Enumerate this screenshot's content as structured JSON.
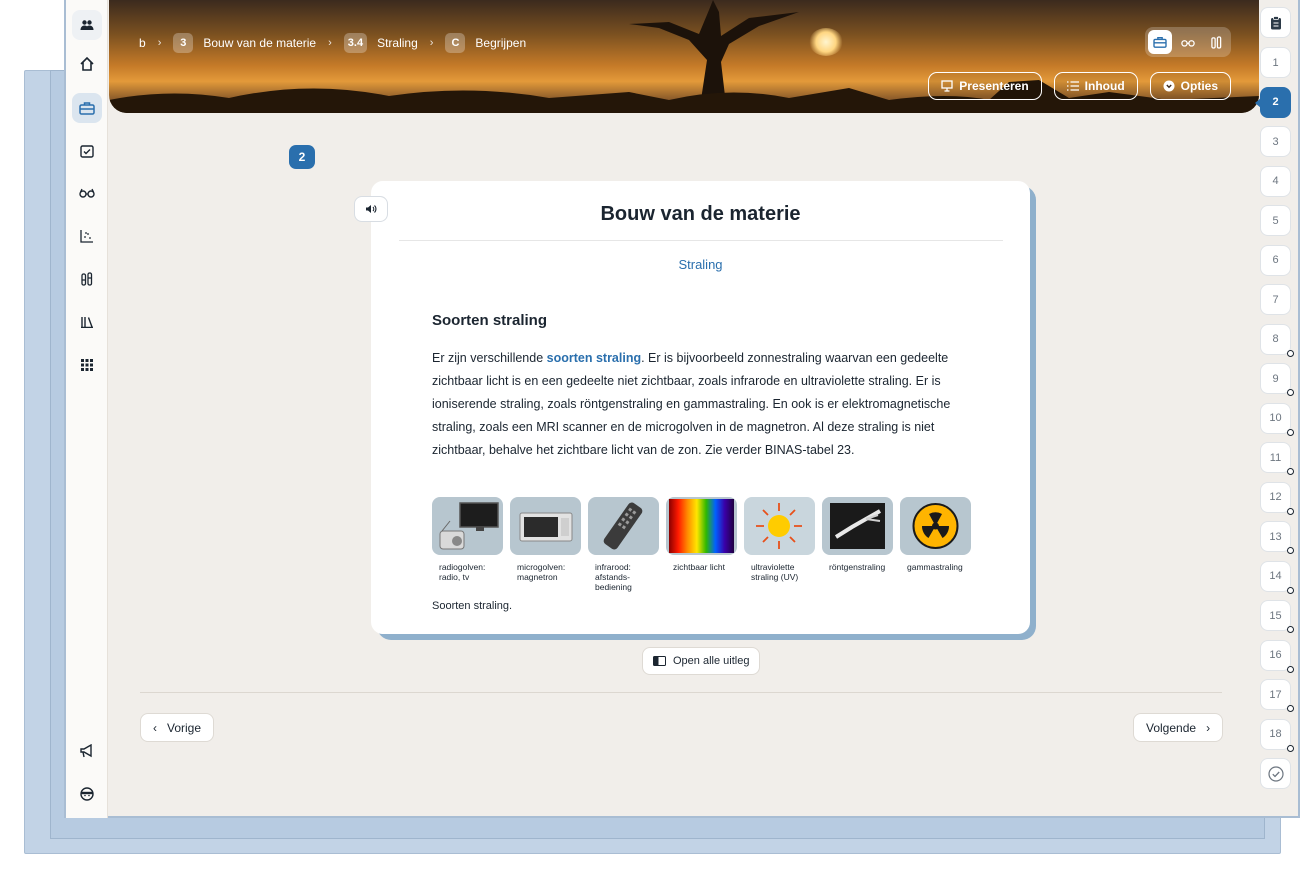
{
  "rail": {
    "items": [
      {
        "icon": "group-icon",
        "glyph": "👥"
      },
      {
        "icon": "home-icon",
        "glyph": "⌂"
      },
      {
        "icon": "briefcase-icon",
        "glyph": "💼"
      },
      {
        "icon": "task-calendar-icon",
        "glyph": "☑"
      },
      {
        "icon": "glasses-icon",
        "glyph": "👓"
      },
      {
        "icon": "chart-icon",
        "glyph": "⁙"
      },
      {
        "icon": "test-tubes-icon",
        "glyph": "⫿"
      },
      {
        "icon": "library-icon",
        "glyph": "ⅲ"
      },
      {
        "icon": "apps-grid-icon",
        "glyph": "⠿"
      },
      {
        "icon": "megaphone-icon",
        "glyph": "📣"
      },
      {
        "icon": "user-avatar-icon",
        "glyph": "☺"
      }
    ]
  },
  "breadcrumb": {
    "root": "b",
    "chapter_num": "3",
    "chapter": "Bouw van de materie",
    "section_num": "3.4",
    "section": "Straling",
    "part_num": "C",
    "part": "Begrijpen"
  },
  "banner": {
    "presenteren": "Presenteren",
    "inhoud": "Inhoud",
    "opties": "Opties"
  },
  "page_badge": "2",
  "card": {
    "title": "Bouw van de materie",
    "subtitle": "Straling",
    "heading": "Soorten straling",
    "para_pre": "Er zijn verschillende ",
    "para_kw": "soorten straling",
    "para_post": ". Er is bijvoorbeeld zonnestraling waarvan een gedeelte zichtbaar licht is en een gedeelte niet zichtbaar, zoals infrarode  en ultraviolette straling. Er is ioniserende straling, zoals röntgenstraling en gammastraling. En ook is er elektromagnetische straling, zoals een MRI scanner en de microgolven in de magnetron. Al deze straling is niet zichtbaar, behalve het zichtbare licht van de zon. Zie verder BINAS-tabel 23.",
    "figures": [
      {
        "caption": "radiogolven: radio, tv"
      },
      {
        "caption": "microgolven: magnetron"
      },
      {
        "caption": "infrarood: afstands-bediening"
      },
      {
        "caption": "zichtbaar licht"
      },
      {
        "caption": "ultraviolette straling (UV)"
      },
      {
        "caption": "röntgenstraling"
      },
      {
        "caption": "gammastraling"
      }
    ],
    "figure_caption": "Soorten straling."
  },
  "open_all": "Open alle uitleg",
  "nav": {
    "prev": "Vorige",
    "next": "Volgende"
  },
  "pager": {
    "pages": [
      "1",
      "2",
      "3",
      "4",
      "5",
      "6",
      "7",
      "8",
      "9",
      "10",
      "11",
      "12",
      "13",
      "14",
      "15",
      "16",
      "17",
      "18"
    ],
    "active": "2",
    "dotted_from": 8
  },
  "colors": {
    "accent": "#2a6fad",
    "background": "#f1eeea"
  }
}
